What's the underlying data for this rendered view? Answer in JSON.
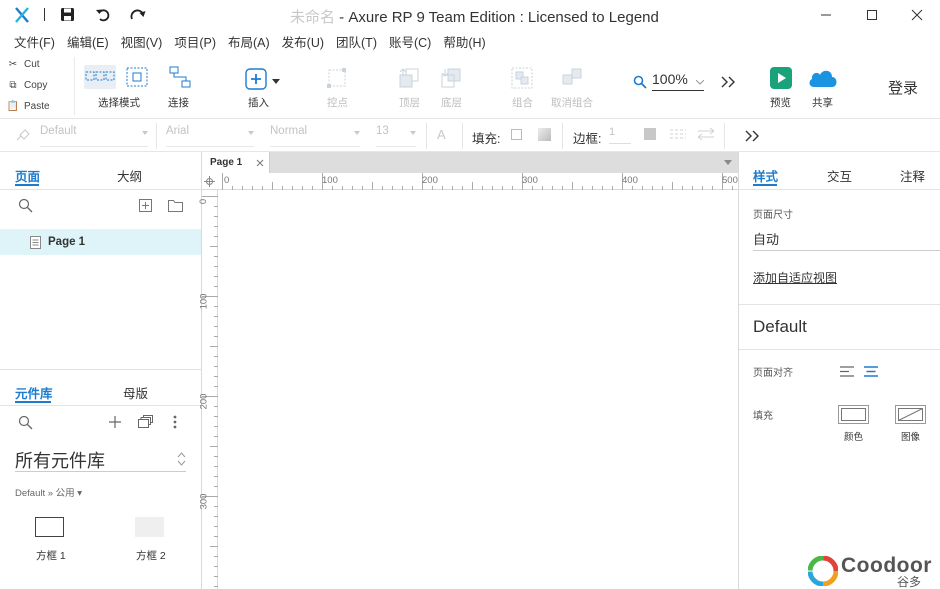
{
  "title": {
    "doc_name": "未命名",
    "separator": " - ",
    "app_title": "Axure RP 9 Team Edition : Licensed to Legend"
  },
  "menu": [
    "文件(F)",
    "编辑(E)",
    "视图(V)",
    "项目(P)",
    "布局(A)",
    "发布(U)",
    "团队(T)",
    "账号(C)",
    "帮助(H)"
  ],
  "clipboard": {
    "cut": "Cut",
    "copy": "Copy",
    "paste": "Paste"
  },
  "toolbar": {
    "select_mode": "选择模式",
    "connect": "连接",
    "insert": "插入",
    "point": "控点",
    "top": "顶层",
    "bottom": "底层",
    "group": "组合",
    "ungroup": "取消组合",
    "zoom": "100%",
    "preview": "预览",
    "share": "共享",
    "login": "登录"
  },
  "format": {
    "style": "Default",
    "font": "Arial",
    "weight": "Normal",
    "size": "13",
    "fill_label": "填充:",
    "border_label": "边框:",
    "border_value": "1"
  },
  "left": {
    "tabs": {
      "pages": "页面",
      "outline": "大纲"
    },
    "pages": [
      "Page 1"
    ],
    "lib_tabs": {
      "libraries": "元件库",
      "masters": "母版"
    },
    "lib_selector": "所有元件库",
    "lib_path": "Default » 公用 ▾",
    "widgets": [
      "方框 1",
      "方框 2"
    ]
  },
  "canvas": {
    "tab": "Page 1",
    "h_ticks": [
      "0",
      "100",
      "200",
      "300",
      "400",
      "500"
    ],
    "v_ticks": [
      "0",
      "100",
      "200",
      "300"
    ]
  },
  "right": {
    "tabs": {
      "style": "样式",
      "interactions": "交互",
      "notes": "注释"
    },
    "page_size_label": "页面尺寸",
    "page_size_value": "自动",
    "adaptive_link": "添加自适应视图",
    "style_name": "Default",
    "align_label": "页面对齐",
    "fill_label": "填充",
    "fill_color": "颜色",
    "fill_image": "图像"
  },
  "watermark": {
    "brand": "Coodoor",
    "sub": "谷多"
  },
  "colors": {
    "accent": "#1d7ccf",
    "preview": "#1aa37a",
    "share": "#1a93e0"
  }
}
